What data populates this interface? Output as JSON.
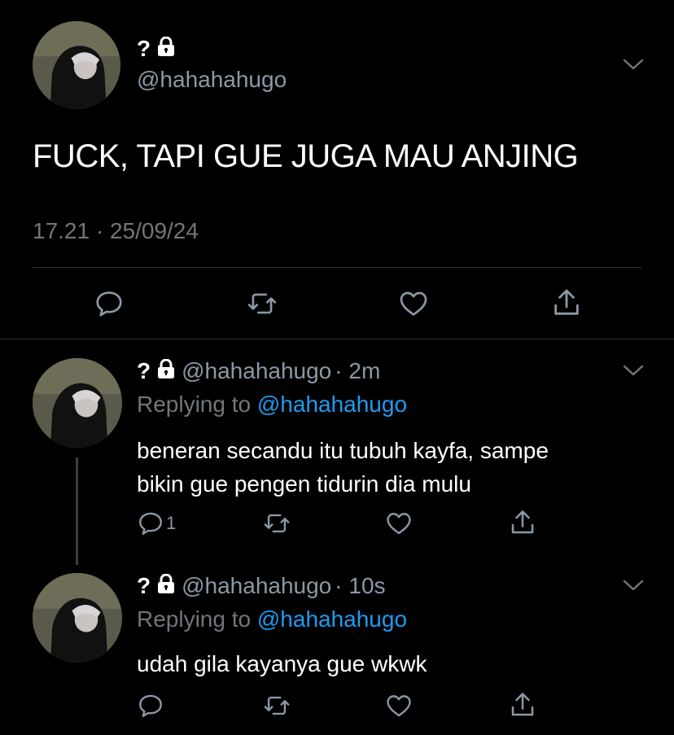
{
  "main_tweet": {
    "display_name": "?",
    "handle": "@hahahahugo",
    "text": "FUCK, TAPI GUE JUGA MAU ANJING",
    "timestamp": "17.21 · 25/09/24"
  },
  "replies": [
    {
      "display_name": "?",
      "handle": "@hahahahugo",
      "time": "· 2m",
      "replying_prefix": "Replying to",
      "replying_to": "@hahahahugo",
      "text_line1": "beneran secandu itu tubuh kayfa, sampe",
      "text_line2": "bikin gue pengen tidurin dia mulu",
      "reply_count": "1"
    },
    {
      "display_name": "?",
      "handle": "@hahahahugo",
      "time": "· 10s",
      "replying_prefix": "Replying to",
      "replying_to": "@hahahahugo",
      "text_line1": "udah gila kayanya gue wkwk",
      "reply_count": ""
    }
  ],
  "colors": {
    "background": "#000000",
    "text": "#e7e9ea",
    "muted": "#71767b",
    "link": "#1d9bf0",
    "divider": "#2f3336"
  },
  "icons": [
    "lock-icon",
    "chevron-down-icon",
    "reply-icon",
    "retweet-icon",
    "like-icon",
    "share-icon"
  ]
}
